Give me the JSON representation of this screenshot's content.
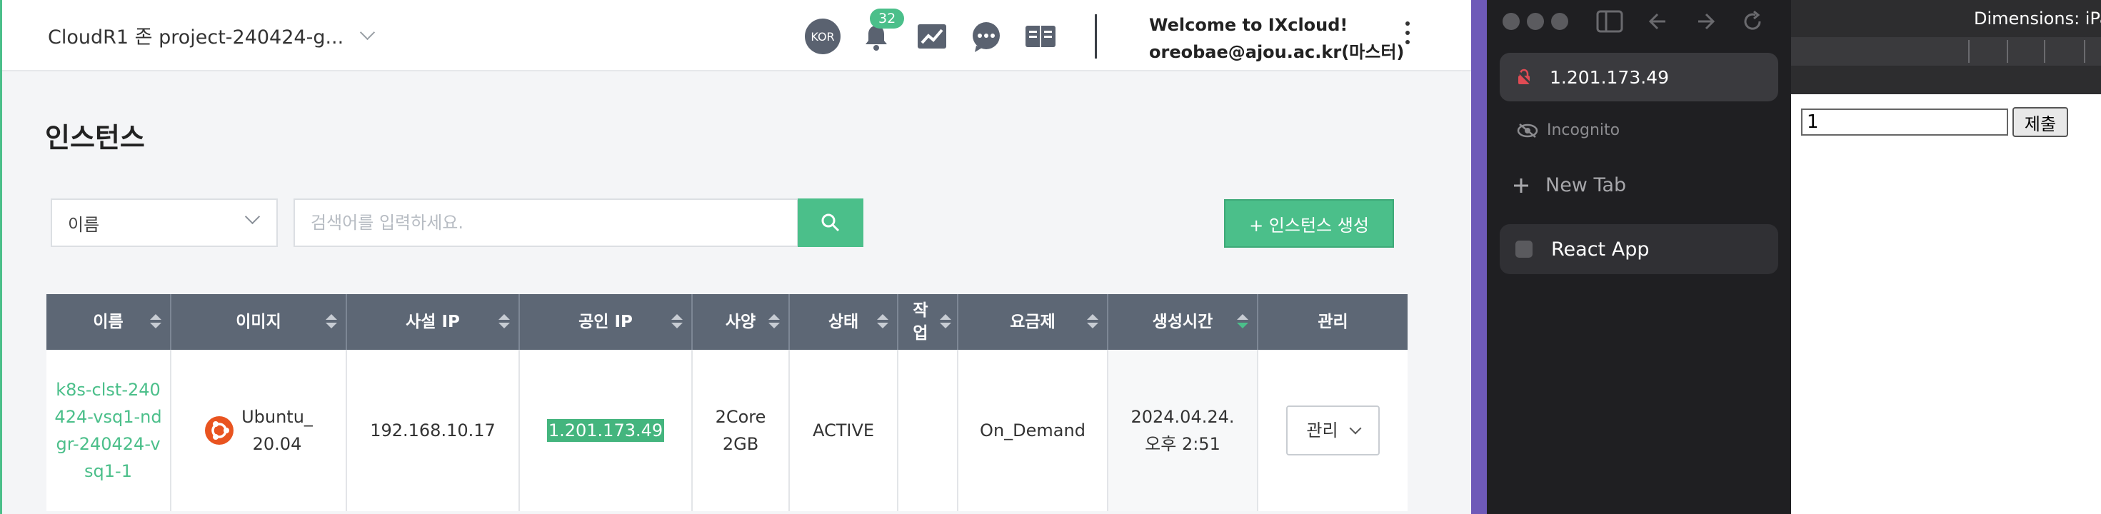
{
  "console": {
    "project_selector": "CloudR1 존 project-240424-g...",
    "language_badge": "KOR",
    "notification_count": "32",
    "welcome_line1": "Welcome to IXcloud!",
    "welcome_line2": "oreobae@ajou.ac.kr(마스터)",
    "page_title": "인스턴스",
    "search_field": "이름",
    "search_placeholder": "검색어를 입력하세요.",
    "create_button": "+ 인스턴스 생성",
    "accent_color": "#4bbf8a",
    "table": {
      "columns": [
        "이름",
        "이미지",
        "사설 IP",
        "공인 IP",
        "사양",
        "상태",
        "작업",
        "요금제",
        "생성시간",
        "관리"
      ],
      "sorted_column": "생성시간",
      "rows": [
        {
          "name": "k8s-clst-240424-vsq1-ndgr-240424-vsq1-1",
          "image": "Ubuntu_20.04",
          "private_ip": "192.168.10.17",
          "public_ip": "1.201.173.49",
          "spec": "2Core 2GB",
          "status": "ACTIVE",
          "task": "",
          "plan": "On_Demand",
          "created": "2024.04.24. 오후 2:51",
          "manage": "관리"
        }
      ]
    }
  },
  "browser": {
    "address": "1.201.173.49",
    "incognito_label": "Incognito",
    "new_tab_label": "New Tab",
    "tab_title": "React App"
  },
  "devtools": {
    "dimensions_label": "Dimensions: iPa",
    "input_value": "1",
    "submit_label": "제출"
  }
}
